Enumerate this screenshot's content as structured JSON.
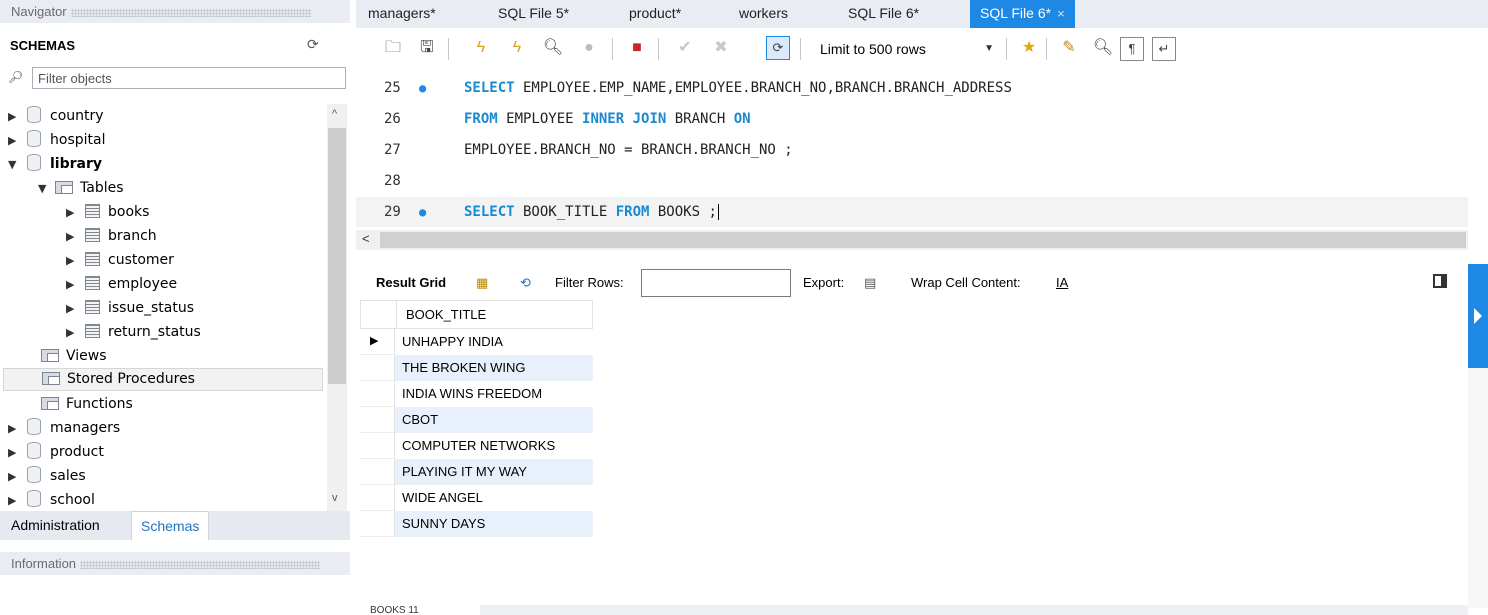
{
  "navigator": {
    "title": "Navigator",
    "schemas_label": "SCHEMAS",
    "filter_placeholder": "Filter objects",
    "tree": [
      {
        "label": "country",
        "type": "db",
        "level": 0,
        "expanded": false
      },
      {
        "label": "hospital",
        "type": "db",
        "level": 0,
        "expanded": false
      },
      {
        "label": "library",
        "type": "db",
        "level": 0,
        "expanded": true,
        "bold": true
      },
      {
        "label": "Tables",
        "type": "folder",
        "level": 1,
        "expanded": true
      },
      {
        "label": "books",
        "type": "table",
        "level": 2,
        "expanded": false
      },
      {
        "label": "branch",
        "type": "table",
        "level": 2,
        "expanded": false
      },
      {
        "label": "customer",
        "type": "table",
        "level": 2,
        "expanded": false
      },
      {
        "label": "employee",
        "type": "table",
        "level": 2,
        "expanded": false
      },
      {
        "label": "issue_status",
        "type": "table",
        "level": 2,
        "expanded": false
      },
      {
        "label": "return_status",
        "type": "table",
        "level": 2,
        "expanded": false
      },
      {
        "label": "Views",
        "type": "folder",
        "level": 1,
        "leaf": true
      },
      {
        "label": "Stored Procedures",
        "type": "folder",
        "level": 1,
        "leaf": true,
        "selected": true
      },
      {
        "label": "Functions",
        "type": "folder",
        "level": 1,
        "leaf": true
      },
      {
        "label": "managers",
        "type": "db",
        "level": 0,
        "expanded": false
      },
      {
        "label": "product",
        "type": "db",
        "level": 0,
        "expanded": false
      },
      {
        "label": "sales",
        "type": "db",
        "level": 0,
        "expanded": false
      },
      {
        "label": "school",
        "type": "db",
        "level": 0,
        "expanded": false
      }
    ],
    "tabs": [
      "Administration",
      "Schemas"
    ],
    "active_tab": "Schemas",
    "information_title": "Information"
  },
  "query_tabs": [
    {
      "label": "managers*"
    },
    {
      "label": "SQL File 5*"
    },
    {
      "label": "product*"
    },
    {
      "label": "workers"
    },
    {
      "label": "SQL File 6*"
    },
    {
      "label": "SQL File 6*",
      "active": true,
      "close": "×"
    }
  ],
  "toolbar": {
    "limit_label": "Limit to 500 rows",
    "icons": [
      "folder-open-icon",
      "save-icon",
      "execute-icon",
      "execute-current-icon",
      "explain-icon",
      "stop-icon",
      "toggle-error-icon",
      "commit-icon",
      "rollback-icon",
      "autocommit-icon",
      "bookmark-icon",
      "beautify-icon",
      "find-icon",
      "invisible-chars-icon",
      "wrap-icon"
    ]
  },
  "editor": {
    "lines": [
      {
        "num": "25",
        "dot": true,
        "tokens": [
          {
            "t": "SELECT",
            "kw": true
          },
          {
            "t": " EMPLOYEE.EMP_NAME,EMPLOYEE.BRANCH_NO,BRANCH.BRANCH_ADDRESS"
          }
        ]
      },
      {
        "num": "26",
        "dot": false,
        "tokens": [
          {
            "t": "FROM",
            "kw": true
          },
          {
            "t": " EMPLOYEE "
          },
          {
            "t": "INNER JOIN",
            "kw": true
          },
          {
            "t": " BRANCH "
          },
          {
            "t": "ON",
            "kw": true
          }
        ]
      },
      {
        "num": "27",
        "dot": false,
        "tokens": [
          {
            "t": "EMPLOYEE.BRANCH_NO = BRANCH.BRANCH_NO ;"
          }
        ]
      },
      {
        "num": "28",
        "dot": false,
        "tokens": []
      },
      {
        "num": "29",
        "dot": true,
        "tokens": [
          {
            "t": "SELECT",
            "kw": true
          },
          {
            "t": " BOOK_TITLE "
          },
          {
            "t": "FROM",
            "kw": true
          },
          {
            "t": " BOOKS ;"
          }
        ]
      }
    ]
  },
  "result_toolbar": {
    "result_grid": "Result Grid",
    "filter_rows": "Filter Rows:",
    "export": "Export:",
    "wrap": "Wrap Cell Content:"
  },
  "result": {
    "column": "BOOK_TITLE",
    "rows": [
      "UNHAPPY INDIA",
      "THE BROKEN WING",
      "INDIA WINS FREEDOM",
      "CBOT",
      "COMPUTER NETWORKS",
      "PLAYING IT MY WAY",
      "WIDE ANGEL",
      "SUNNY DAYS"
    ]
  },
  "bottom": {
    "label": "BOOKS 11"
  },
  "colors": {
    "accent": "#1e88e5",
    "keyword": "#1a8ad0",
    "alt_row": "#e8f1fb"
  }
}
